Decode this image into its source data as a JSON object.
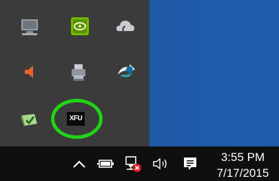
{
  "overflow_tray": {
    "icons": [
      {
        "name": "network-monitor-icon"
      },
      {
        "name": "nvidia-icon"
      },
      {
        "name": "onedrive-icon"
      },
      {
        "name": "speaker-muted-icon"
      },
      {
        "name": "printer-icon"
      },
      {
        "name": "sync-icon"
      },
      {
        "name": "security-check-icon"
      },
      {
        "name": "xfu-icon",
        "label": "XFU",
        "highlighted": true
      }
    ]
  },
  "taskbar": {
    "show_hidden_icons": "chevron-up-icon",
    "battery": "battery-icon",
    "network": "network-error-icon",
    "volume": "volume-icon",
    "action_center": "notification-icon"
  },
  "clock": {
    "time": "3:55 PM",
    "date": "7/17/2015"
  },
  "colors": {
    "flyout": "#3b3b3b",
    "taskbar": "#0f0f10",
    "desktop": "#1e5aa6",
    "highlight": "#22d318"
  }
}
